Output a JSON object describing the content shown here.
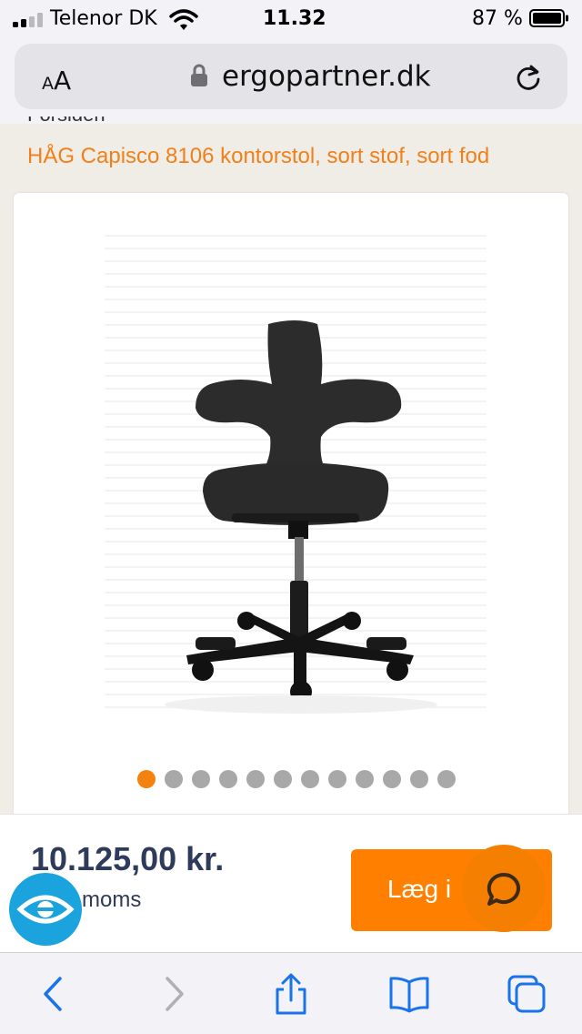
{
  "status_bar": {
    "carrier": "Telenor DK",
    "time": "11.32",
    "battery_percent": "87 %",
    "battery_level": 0.87,
    "signal_bars_filled": 2,
    "signal_bars_total": 4
  },
  "browser": {
    "text_size_label_small": "A",
    "text_size_label_large": "A",
    "url": "ergopartner.dk"
  },
  "page": {
    "breadcrumb_prev": "Forsiden",
    "breadcrumb_current": "HÅG Capisco 8106 kontorstol, sort stof, sort fod",
    "gallery": {
      "dot_count": 12,
      "active_index": 0
    }
  },
  "buy_bar": {
    "price": "10.125,00 kr.",
    "vat_note": "moms",
    "add_to_cart_label": "Læg i"
  },
  "toolbar": {
    "icons": [
      "back-icon",
      "forward-icon",
      "share-icon",
      "bookmarks-icon",
      "tabs-icon"
    ]
  },
  "colors": {
    "accent_orange": "#f5820f",
    "price_text": "#2e3b5a",
    "link_blue": "#1a73e8",
    "badge_blue": "#1aa3dd"
  }
}
